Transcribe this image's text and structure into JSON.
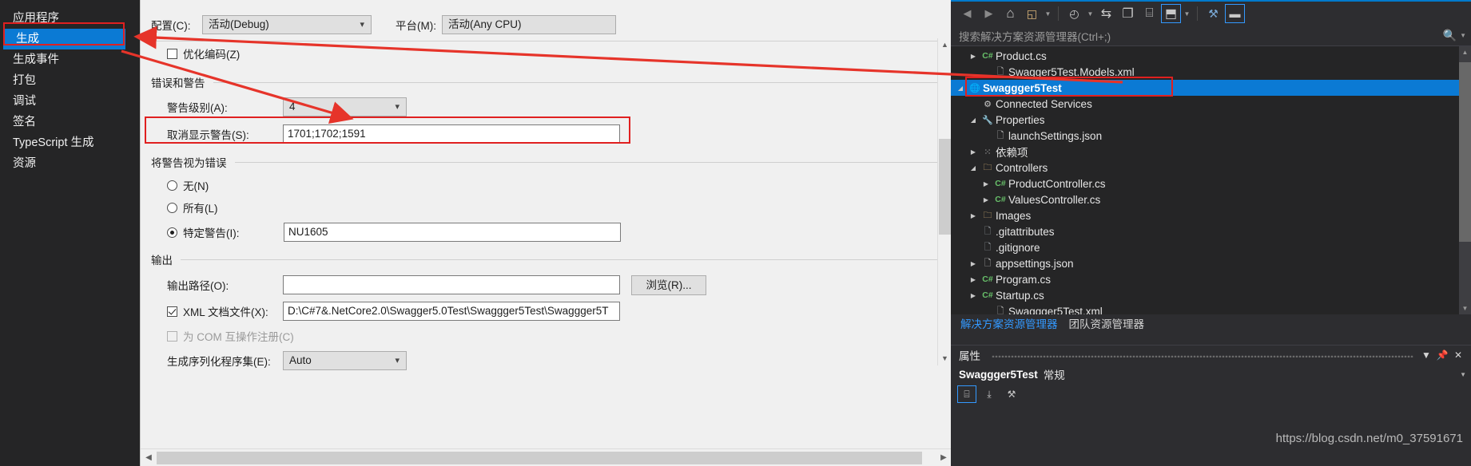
{
  "categories": {
    "items": [
      {
        "label": "应用程序",
        "selected": false
      },
      {
        "label": "生成",
        "selected": true
      },
      {
        "label": "生成事件",
        "selected": false
      },
      {
        "label": "打包",
        "selected": false
      },
      {
        "label": "调试",
        "selected": false
      },
      {
        "label": "签名",
        "selected": false
      },
      {
        "label": "TypeScript 生成",
        "selected": false
      },
      {
        "label": "资源",
        "selected": false
      }
    ]
  },
  "build_page": {
    "config_label": "配置(C):",
    "config_value": "活动(Debug)",
    "platform_label": "平台(M):",
    "platform_value": "活动(Any CPU)",
    "optimize_label": "优化编码(Z)",
    "errors_group": "错误和警告",
    "warning_level_label": "警告级别(A):",
    "warning_level_value": "4",
    "suppress_label": "取消显示警告(S):",
    "suppress_value": "1701;1702;1591",
    "treat_group": "将警告视为错误",
    "radio_none": "无(N)",
    "radio_all": "所有(L)",
    "radio_specific": "特定警告(I):",
    "specific_value": "NU1605",
    "output_group": "输出",
    "output_path_label": "输出路径(O):",
    "output_path_value": "",
    "xml_doc_label": "XML 文档文件(X):",
    "xml_doc_value": "D:\\C#7&.NetCore2.0\\Swagger5.0Test\\Swaggger5Test\\Swaggger5T",
    "browse_label": "浏览(R)...",
    "com_interop_label": "为 COM 互操作注册(C)",
    "serialization_label": "生成序列化程序集(E):",
    "serialization_value": "Auto"
  },
  "solution_explorer": {
    "search_placeholder": "搜索解决方案资源管理器(Ctrl+;)",
    "toolbar": [
      {
        "name": "back-icon",
        "glyph": "◀"
      },
      {
        "name": "forward-icon",
        "glyph": "▶"
      },
      {
        "name": "home-icon",
        "glyph": "⌂"
      },
      {
        "name": "sync-with-active-document-icon",
        "glyph": "◱"
      },
      {
        "name": "pending-changes-filter-icon",
        "glyph": "◴"
      },
      {
        "name": "refresh-icon",
        "glyph": "⇆"
      },
      {
        "name": "collapse-all-icon",
        "glyph": "❐"
      },
      {
        "name": "show-all-files-icon",
        "glyph": "⌸"
      },
      {
        "name": "view-code-icon",
        "glyph": "⬒"
      },
      {
        "name": "properties-icon",
        "glyph": "⚒"
      },
      {
        "name": "preview-selected-items-icon",
        "glyph": "▬"
      }
    ],
    "tree": [
      {
        "label": "Product.cs",
        "indent": 2,
        "expander": "collapsed",
        "icon": "cs",
        "selected": false
      },
      {
        "label": "Swagger5Test.Models.xml",
        "indent": 3,
        "expander": "none",
        "icon": "xml",
        "selected": false
      },
      {
        "label": "Swaggger5Test",
        "indent": 1,
        "expander": "expanded",
        "icon": "globe",
        "selected": true
      },
      {
        "label": "Connected Services",
        "indent": 2,
        "expander": "none",
        "icon": "conn",
        "selected": false
      },
      {
        "label": "Properties",
        "indent": 2,
        "expander": "expanded",
        "icon": "wrench",
        "selected": false
      },
      {
        "label": "launchSettings.json",
        "indent": 3,
        "expander": "none",
        "icon": "json",
        "selected": false
      },
      {
        "label": "依赖项",
        "indent": 2,
        "expander": "collapsed",
        "icon": "deps",
        "selected": false
      },
      {
        "label": "Controllers",
        "indent": 2,
        "expander": "expanded",
        "icon": "folder",
        "selected": false
      },
      {
        "label": "ProductController.cs",
        "indent": 3,
        "expander": "collapsed",
        "icon": "cs",
        "selected": false
      },
      {
        "label": "ValuesController.cs",
        "indent": 3,
        "expander": "collapsed",
        "icon": "cs",
        "selected": false
      },
      {
        "label": "Images",
        "indent": 2,
        "expander": "collapsed",
        "icon": "folder",
        "selected": false
      },
      {
        "label": ".gitattributes",
        "indent": 2,
        "expander": "none",
        "icon": "lockfile",
        "selected": false
      },
      {
        "label": ".gitignore",
        "indent": 2,
        "expander": "none",
        "icon": "lockfile",
        "selected": false
      },
      {
        "label": "appsettings.json",
        "indent": 2,
        "expander": "collapsed",
        "icon": "json",
        "selected": false
      },
      {
        "label": "Program.cs",
        "indent": 2,
        "expander": "collapsed",
        "icon": "cs",
        "selected": false
      },
      {
        "label": "Startup.cs",
        "indent": 2,
        "expander": "collapsed",
        "icon": "cs",
        "selected": false
      },
      {
        "label": "Swaggger5Test.xml",
        "indent": 3,
        "expander": "none",
        "icon": "xml",
        "selected": false
      }
    ],
    "tabs": [
      {
        "label": "解决方案资源管理器",
        "active": true
      },
      {
        "label": "团队资源管理器",
        "active": false
      }
    ]
  },
  "properties_pane": {
    "title": "属性",
    "object_name": "Swaggger5Test",
    "object_category": "常规",
    "header_icons": [
      {
        "name": "dropdown-icon",
        "glyph": "▼"
      },
      {
        "name": "pin-icon",
        "glyph": "⍁"
      },
      {
        "name": "close-icon",
        "glyph": "✕"
      }
    ],
    "toolbar_icons": [
      {
        "name": "categorized-view-icon",
        "glyph": "⌸",
        "boxed": true
      },
      {
        "name": "alphabetical-view-icon",
        "glyph": "⤓",
        "boxed": false
      },
      {
        "name": "property-pages-icon",
        "glyph": "⚒",
        "boxed": false
      }
    ]
  },
  "watermark": {
    "text": "https://blog.csdn.net/m0_37591671"
  },
  "colors": {
    "accent": "#007acc",
    "selection": "#0b7ad4",
    "annotation_red": "#e02020",
    "dark_bg": "#2d2d30",
    "tree_bg": "#252526",
    "form_bg": "#f0f0f0"
  }
}
